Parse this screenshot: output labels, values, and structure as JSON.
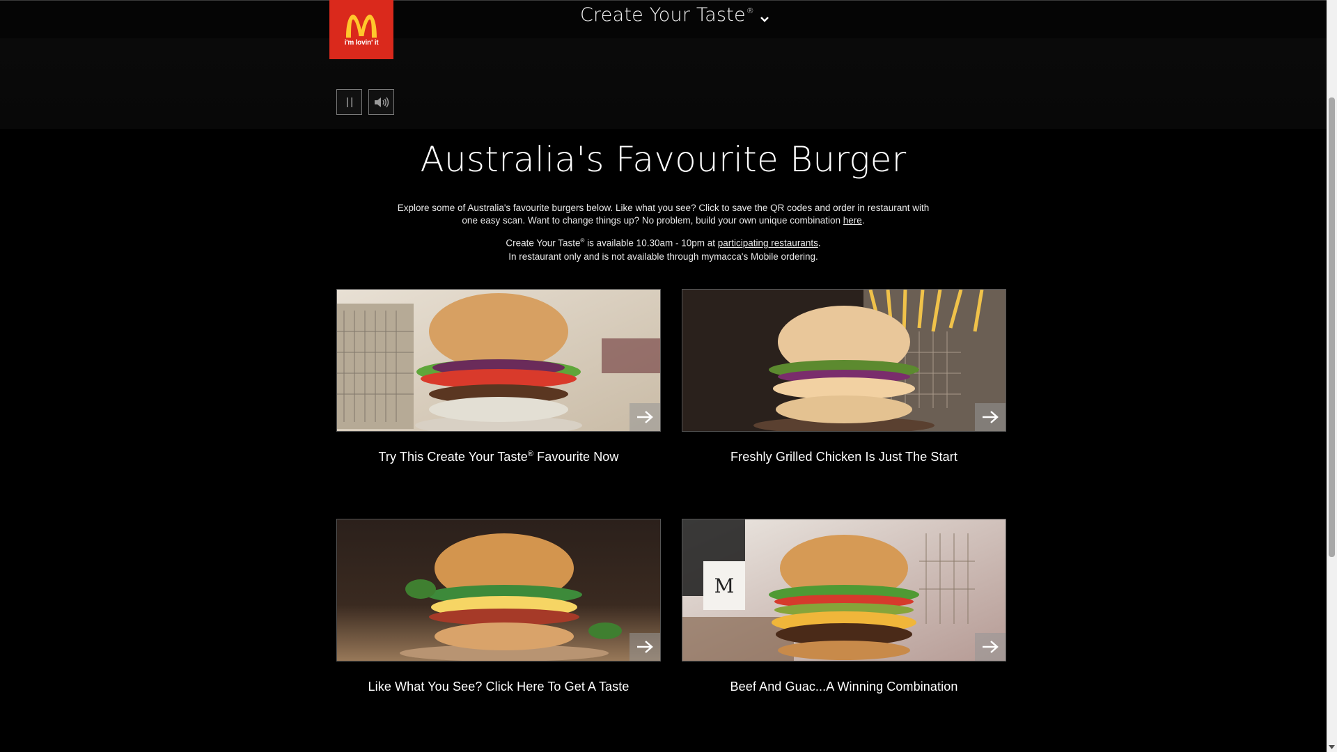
{
  "brand": {
    "logo_text": "i'm lovin' it",
    "logo_color": "#da291c",
    "logo_arch_color": "#ffc72c"
  },
  "nav": {
    "title": "Create Your Taste",
    "title_mark": "®",
    "chevron_icon": "chevron-down-icon"
  },
  "media": {
    "pause_icon": "pause-icon",
    "sound_icon": "speaker-icon"
  },
  "hero": {
    "headline": "Australia's Favourite Burger",
    "intro_text": "Explore some of Australia's favourite burgers below. Like what you see? Click to save the QR codes and order in restaurant with one easy scan. Want to change things up? No problem, build your own unique combination ",
    "intro_link": "here",
    "intro_end": ".",
    "avail_prefix": "Create Your Taste",
    "avail_mark": "®",
    "avail_middle": " is available 10.30am  - 10pm at ",
    "avail_link": "participating restaurants",
    "avail_end": ".",
    "avail_line2": "In restaurant only and is not available through mymacca's Mobile ordering."
  },
  "cards": [
    {
      "caption_pre": "Try This Create Your Taste",
      "caption_mark": "®",
      "caption_post": " Favourite Now",
      "arrow_icon": "arrow-right-icon"
    },
    {
      "caption": "Freshly Grilled Chicken Is Just The Start",
      "arrow_icon": "arrow-right-icon"
    },
    {
      "caption": "Like What You See? Click Here To Get A Taste",
      "arrow_icon": "arrow-right-icon"
    },
    {
      "caption": "Beef And Guac...A Winning Combination",
      "arrow_icon": "arrow-right-icon"
    }
  ]
}
